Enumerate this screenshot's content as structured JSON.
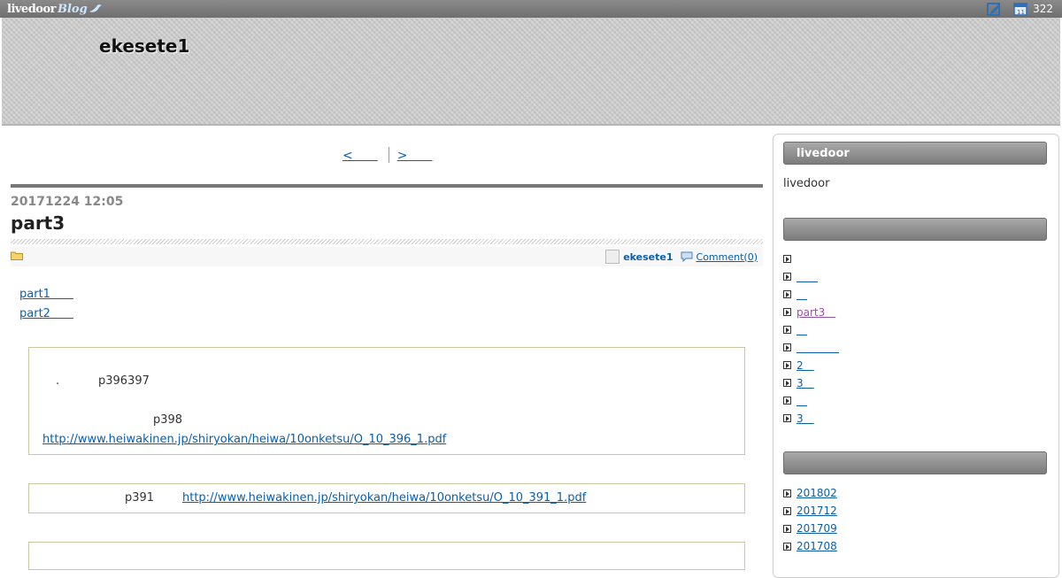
{
  "topbar": {
    "logo_main": "livedoor",
    "logo_sub": "Blog",
    "count": "322"
  },
  "header": {
    "blog_title": "ekesete1"
  },
  "pager": {
    "prev": "<　　",
    "next": ">　　"
  },
  "post": {
    "date": "20171224 12:05",
    "title": "part3",
    "author": "ekesete1",
    "comments": "Comment(0)",
    "links": [
      "part1　　",
      "part2　　"
    ],
    "quote1": {
      "line1": "p396397",
      "line2": "p398",
      "link": "http://www.heiwakinen.jp/shiryokan/heiwa/10onketsu/O_10_396_1.pdf"
    },
    "quote2": {
      "text": "p391",
      "link": "http://www.heiwakinen.jp/shiryokan/heiwa/10onketsu/O_10_391_1.pdf"
    }
  },
  "sidebar": {
    "head1": "livedoor",
    "text1": "livedoor",
    "head2": "",
    "list1": [
      "",
      "　　",
      "　",
      "part3　",
      "　",
      "　　　　",
      "2　",
      "3　",
      "　",
      "3　"
    ],
    "head3": "",
    "archives": [
      "201802",
      "201712",
      "201709",
      "201708"
    ]
  }
}
